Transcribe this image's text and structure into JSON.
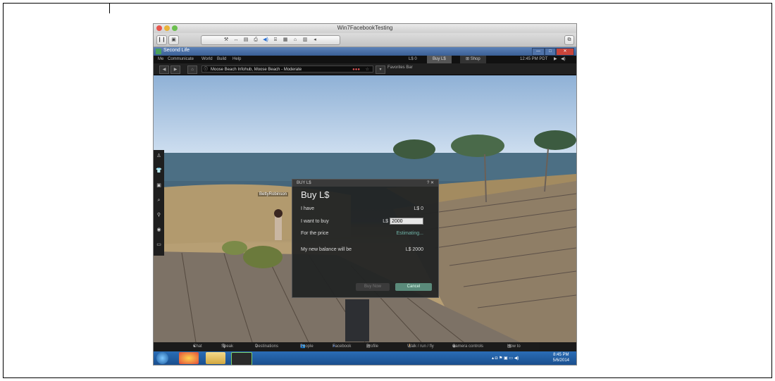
{
  "mac_window": {
    "title": "Win7FacebookTesting"
  },
  "app": {
    "title": "Second Life",
    "window_controls": [
      "—",
      "□",
      "✕"
    ],
    "menu": [
      "Me",
      "Communicate",
      "World",
      "Build",
      "Help"
    ],
    "balance": "L$ 0",
    "buy_label": "Buy L$",
    "shop_label": "Shop",
    "time": "12:45 PM PDT",
    "location": "Moose Beach Infohub, Moose Beach - Moderate",
    "favorites": "Favorites Bar"
  },
  "scene": {
    "avatar_name": "BettyRobinson"
  },
  "dialog": {
    "header": "BUY L$",
    "title": "Buy L$",
    "i_have_label": "I have",
    "i_have_value": "L$ 0",
    "want_label": "I want to buy",
    "want_currency": "L$",
    "want_value": "2000",
    "price_label": "For the price",
    "price_value": "Estimating...",
    "balance_label": "My new balance will be",
    "balance_value": "L$ 2000",
    "buy_now": "Buy Now",
    "cancel": "Cancel",
    "help_close": "? ✕"
  },
  "bottom_toolbar": [
    "Chat",
    "Speak",
    "Destinations",
    "People",
    "Facebook",
    "Profile",
    "Walk / run / fly",
    "Camera controls",
    "How to"
  ],
  "taskbar": {
    "time": "8:45 PM",
    "date": "5/6/2014"
  },
  "colors": {
    "accent": "#5a8a7a",
    "estimating": "#6fb3a7"
  }
}
